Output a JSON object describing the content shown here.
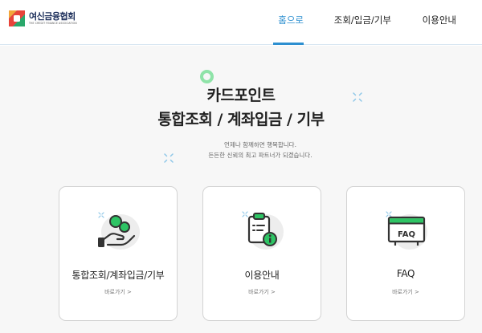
{
  "header": {
    "logo": {
      "name": "여신금융협회",
      "subtitle": "THE CREDIT FINANCE ASSOCIATION"
    },
    "nav": [
      {
        "label": "홈으로",
        "active": true
      },
      {
        "label": "조회/입금/기부",
        "active": false
      },
      {
        "label": "이용안내",
        "active": false
      }
    ]
  },
  "hero": {
    "title_line1": "카드포인트",
    "title_line2": "통합조회 / 계좌입금 / 기부",
    "desc_line1": "언제나 함께하면 행복합니다.",
    "desc_line2": "든든한 신뢰의 최고 파트너가 되겠습니다."
  },
  "cards": [
    {
      "title": "통합조회/계좌입금/기부",
      "link": "바로가기 >",
      "icon": "coin-hand-icon"
    },
    {
      "title": "이용안내",
      "link": "바로가기 >",
      "icon": "clipboard-info-icon"
    },
    {
      "title": "FAQ",
      "link": "바로가기 >",
      "icon": "faq-window-icon"
    }
  ],
  "colors": {
    "accent_blue": "#2d8fd0",
    "accent_green": "#2ec464",
    "icon_dark": "#333333",
    "icon_bg": "#ededed"
  }
}
